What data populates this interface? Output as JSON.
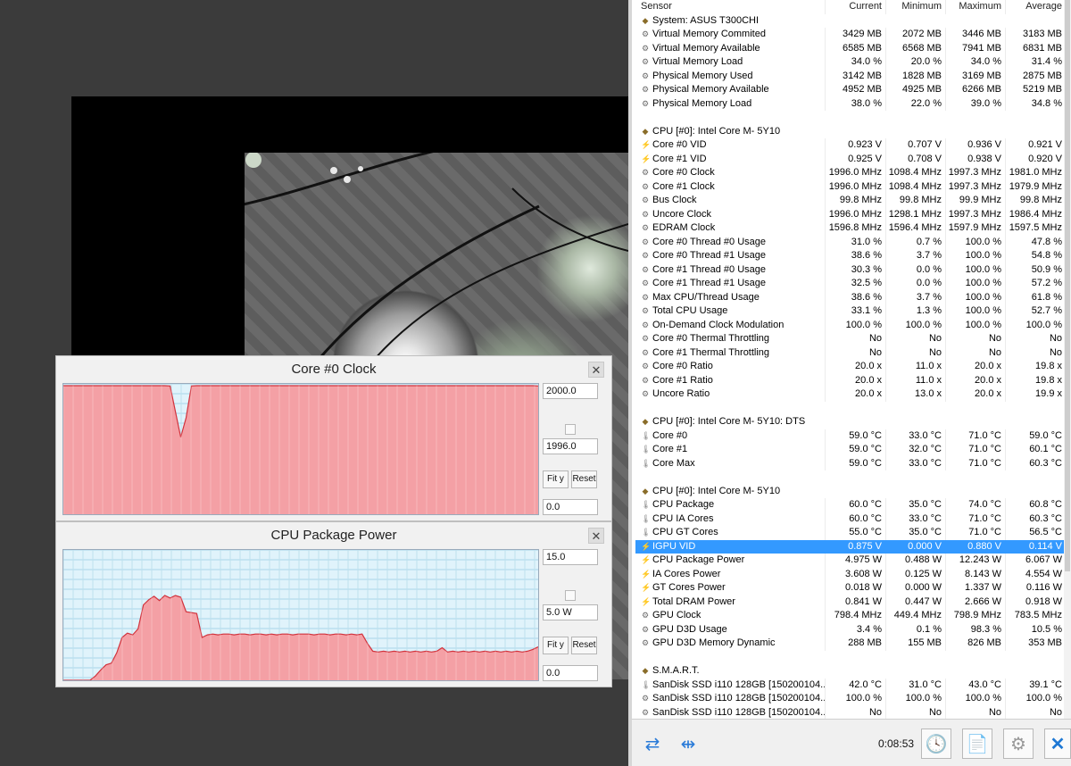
{
  "graph1": {
    "title": "Core #0 Clock",
    "max_field": "2000.0",
    "current_field": "1996.0",
    "min_field": "0.0",
    "fit_label": "Fit y",
    "reset_label": "Reset",
    "series": [
      2000,
      2000,
      2000,
      2000,
      2000,
      2000,
      2000,
      2000,
      2000,
      2000,
      2000,
      2000,
      2000,
      2000,
      2000,
      2000,
      2000,
      2000,
      2000,
      2000,
      1996,
      1600,
      1200,
      1500,
      1996,
      2000,
      2000,
      2000,
      2000,
      2000,
      2000,
      2000,
      2000,
      2000,
      2000,
      2000,
      2000,
      2000,
      2000,
      2000,
      2000,
      2000,
      2000,
      2000,
      2000,
      2000,
      2000,
      2000,
      2000,
      2000,
      2000,
      2000,
      2000,
      2000,
      2000,
      2000,
      2000,
      2000,
      2000,
      2000,
      2000,
      2000,
      2000,
      2000,
      2000,
      2000,
      2000,
      2000,
      2000,
      2000,
      2000,
      2000,
      2000,
      2000,
      2000,
      2000,
      2000,
      2000,
      2000,
      2000,
      2000,
      2000,
      2000,
      2000,
      2000,
      2000,
      2000,
      2000,
      2000,
      1996
    ],
    "ymax": 2000,
    "colors": {
      "fill": "#f4a0a5",
      "line": "#d2323c",
      "grid": "#a8d6e8",
      "bg": "#e0f3fb"
    }
  },
  "graph2": {
    "title": "CPU Package Power",
    "max_field": "15.0",
    "current_field": "5.0 W",
    "min_field": "0.0",
    "fit_label": "Fit y",
    "reset_label": "Reset",
    "series": [
      0,
      0,
      0,
      0,
      0,
      0,
      0.5,
      1.2,
      1.8,
      2.0,
      3.2,
      5.0,
      5.5,
      5.3,
      6.0,
      8.8,
      9.4,
      9.8,
      9.3,
      9.9,
      9.6,
      9.9,
      9.7,
      8.0,
      7.9,
      7.8,
      5.0,
      5.3,
      5.4,
      5.3,
      5.4,
      5.4,
      5.3,
      5.4,
      5.4,
      5.3,
      5.4,
      5.4,
      5.3,
      5.4,
      5.3,
      5.4,
      5.4,
      5.3,
      5.4,
      5.4,
      5.4,
      5.3,
      5.4,
      5.4,
      5.3,
      5.4,
      5.4,
      5.3,
      5.4,
      5.3,
      5.4,
      4.3,
      3.4,
      3.3,
      3.4,
      3.3,
      3.4,
      3.3,
      3.4,
      3.3,
      3.4,
      3.3,
      3.4,
      3.3,
      3.4,
      3.8,
      3.3,
      3.4,
      3.3,
      3.4,
      3.3,
      3.4,
      3.3,
      3.4,
      3.3,
      3.4,
      3.3,
      3.4,
      3.3,
      3.4,
      3.3,
      3.4,
      3.6,
      3.9
    ],
    "ymax": 15,
    "colors": {
      "fill": "#f4a0a5",
      "line": "#d2323c",
      "grid": "#a8d6e8",
      "bg": "#e0f3fb"
    }
  },
  "sensor_panel": {
    "columns": [
      "Sensor",
      "Current",
      "Minimum",
      "Maximum",
      "Average"
    ],
    "rows": [
      {
        "type": "group",
        "label": "System: ASUS T300CHI"
      },
      {
        "type": "item",
        "icon": "gear",
        "label": "Virtual Memory Commited",
        "cur": "3429 MB",
        "min": "2072 MB",
        "max": "3446 MB",
        "avg": "3183 MB"
      },
      {
        "type": "item",
        "icon": "gear",
        "label": "Virtual Memory Available",
        "cur": "6585 MB",
        "min": "6568 MB",
        "max": "7941 MB",
        "avg": "6831 MB"
      },
      {
        "type": "item",
        "icon": "gear",
        "label": "Virtual Memory Load",
        "cur": "34.0 %",
        "min": "20.0 %",
        "max": "34.0 %",
        "avg": "31.4 %"
      },
      {
        "type": "item",
        "icon": "gear",
        "label": "Physical Memory Used",
        "cur": "3142 MB",
        "min": "1828 MB",
        "max": "3169 MB",
        "avg": "2875 MB"
      },
      {
        "type": "item",
        "icon": "gear",
        "label": "Physical Memory Available",
        "cur": "4952 MB",
        "min": "4925 MB",
        "max": "6266 MB",
        "avg": "5219 MB"
      },
      {
        "type": "item",
        "icon": "gear",
        "label": "Physical Memory Load",
        "cur": "38.0 %",
        "min": "22.0 %",
        "max": "39.0 %",
        "avg": "34.8 %"
      },
      {
        "type": "blank"
      },
      {
        "type": "group",
        "label": "CPU [#0]: Intel Core M- 5Y10"
      },
      {
        "type": "item",
        "icon": "bolt",
        "label": "Core #0 VID",
        "cur": "0.923 V",
        "min": "0.707 V",
        "max": "0.936 V",
        "avg": "0.921 V"
      },
      {
        "type": "item",
        "icon": "bolt",
        "label": "Core #1 VID",
        "cur": "0.925 V",
        "min": "0.708 V",
        "max": "0.938 V",
        "avg": "0.920 V"
      },
      {
        "type": "item",
        "icon": "gear",
        "label": "Core #0 Clock",
        "cur": "1996.0 MHz",
        "min": "1098.4 MHz",
        "max": "1997.3 MHz",
        "avg": "1981.0 MHz"
      },
      {
        "type": "item",
        "icon": "gear",
        "label": "Core #1 Clock",
        "cur": "1996.0 MHz",
        "min": "1098.4 MHz",
        "max": "1997.3 MHz",
        "avg": "1979.9 MHz"
      },
      {
        "type": "item",
        "icon": "gear",
        "label": "Bus Clock",
        "cur": "99.8 MHz",
        "min": "99.8 MHz",
        "max": "99.9 MHz",
        "avg": "99.8 MHz"
      },
      {
        "type": "item",
        "icon": "gear",
        "label": "Uncore Clock",
        "cur": "1996.0 MHz",
        "min": "1298.1 MHz",
        "max": "1997.3 MHz",
        "avg": "1986.4 MHz"
      },
      {
        "type": "item",
        "icon": "gear",
        "label": "EDRAM Clock",
        "cur": "1596.8 MHz",
        "min": "1596.4 MHz",
        "max": "1597.9 MHz",
        "avg": "1597.5 MHz"
      },
      {
        "type": "item",
        "icon": "gear",
        "label": "Core #0 Thread #0 Usage",
        "cur": "31.0 %",
        "min": "0.7 %",
        "max": "100.0 %",
        "avg": "47.8 %"
      },
      {
        "type": "item",
        "icon": "gear",
        "label": "Core #0 Thread #1 Usage",
        "cur": "38.6 %",
        "min": "3.7 %",
        "max": "100.0 %",
        "avg": "54.8 %"
      },
      {
        "type": "item",
        "icon": "gear",
        "label": "Core #1 Thread #0 Usage",
        "cur": "30.3 %",
        "min": "0.0 %",
        "max": "100.0 %",
        "avg": "50.9 %"
      },
      {
        "type": "item",
        "icon": "gear",
        "label": "Core #1 Thread #1 Usage",
        "cur": "32.5 %",
        "min": "0.0 %",
        "max": "100.0 %",
        "avg": "57.2 %"
      },
      {
        "type": "item",
        "icon": "gear",
        "label": "Max CPU/Thread Usage",
        "cur": "38.6 %",
        "min": "3.7 %",
        "max": "100.0 %",
        "avg": "61.8 %"
      },
      {
        "type": "item",
        "icon": "gear",
        "label": "Total CPU Usage",
        "cur": "33.1 %",
        "min": "1.3 %",
        "max": "100.0 %",
        "avg": "52.7 %"
      },
      {
        "type": "item",
        "icon": "gear",
        "label": "On-Demand Clock Modulation",
        "cur": "100.0 %",
        "min": "100.0 %",
        "max": "100.0 %",
        "avg": "100.0 %"
      },
      {
        "type": "item",
        "icon": "gear",
        "label": "Core #0 Thermal Throttling",
        "cur": "No",
        "min": "No",
        "max": "No",
        "avg": "No"
      },
      {
        "type": "item",
        "icon": "gear",
        "label": "Core #1 Thermal Throttling",
        "cur": "No",
        "min": "No",
        "max": "No",
        "avg": "No"
      },
      {
        "type": "item",
        "icon": "gear",
        "label": "Core #0 Ratio",
        "cur": "20.0 x",
        "min": "11.0 x",
        "max": "20.0 x",
        "avg": "19.8 x"
      },
      {
        "type": "item",
        "icon": "gear",
        "label": "Core #1 Ratio",
        "cur": "20.0 x",
        "min": "11.0 x",
        "max": "20.0 x",
        "avg": "19.8 x"
      },
      {
        "type": "item",
        "icon": "gear",
        "label": "Uncore Ratio",
        "cur": "20.0 x",
        "min": "13.0 x",
        "max": "20.0 x",
        "avg": "19.9 x"
      },
      {
        "type": "blank"
      },
      {
        "type": "group",
        "label": "CPU [#0]: Intel Core M- 5Y10: DTS"
      },
      {
        "type": "item",
        "icon": "therm",
        "label": "Core #0",
        "cur": "59.0 °C",
        "min": "33.0 °C",
        "max": "71.0 °C",
        "avg": "59.0 °C"
      },
      {
        "type": "item",
        "icon": "therm",
        "label": "Core #1",
        "cur": "59.0 °C",
        "min": "32.0 °C",
        "max": "71.0 °C",
        "avg": "60.1 °C"
      },
      {
        "type": "item",
        "icon": "therm",
        "label": "Core Max",
        "cur": "59.0 °C",
        "min": "33.0 °C",
        "max": "71.0 °C",
        "avg": "60.3 °C"
      },
      {
        "type": "blank"
      },
      {
        "type": "group",
        "label": "CPU [#0]: Intel Core M- 5Y10"
      },
      {
        "type": "item",
        "icon": "therm",
        "label": "CPU Package",
        "cur": "60.0 °C",
        "min": "35.0 °C",
        "max": "74.0 °C",
        "avg": "60.8 °C"
      },
      {
        "type": "item",
        "icon": "therm",
        "label": "CPU IA Cores",
        "cur": "60.0 °C",
        "min": "33.0 °C",
        "max": "71.0 °C",
        "avg": "60.3 °C"
      },
      {
        "type": "item",
        "icon": "therm",
        "label": "CPU GT Cores",
        "cur": "55.0 °C",
        "min": "35.0 °C",
        "max": "71.0 °C",
        "avg": "56.5 °C"
      },
      {
        "type": "item",
        "icon": "bolt",
        "label": "IGPU VID",
        "cur": "0.875 V",
        "min": "0.000 V",
        "max": "0.880 V",
        "avg": "0.114 V",
        "selected": true
      },
      {
        "type": "item",
        "icon": "bolt",
        "label": "CPU Package Power",
        "cur": "4.975 W",
        "min": "0.488 W",
        "max": "12.243 W",
        "avg": "6.067 W"
      },
      {
        "type": "item",
        "icon": "bolt",
        "label": "IA Cores Power",
        "cur": "3.608 W",
        "min": "0.125 W",
        "max": "8.143 W",
        "avg": "4.554 W"
      },
      {
        "type": "item",
        "icon": "bolt",
        "label": "GT Cores Power",
        "cur": "0.018 W",
        "min": "0.000 W",
        "max": "1.337 W",
        "avg": "0.116 W"
      },
      {
        "type": "item",
        "icon": "bolt",
        "label": "Total DRAM Power",
        "cur": "0.841 W",
        "min": "0.447 W",
        "max": "2.666 W",
        "avg": "0.918 W"
      },
      {
        "type": "item",
        "icon": "gear",
        "label": "GPU Clock",
        "cur": "798.4 MHz",
        "min": "449.4 MHz",
        "max": "798.9 MHz",
        "avg": "783.5 MHz"
      },
      {
        "type": "item",
        "icon": "gear",
        "label": "GPU D3D Usage",
        "cur": "3.4 %",
        "min": "0.1 %",
        "max": "98.3 %",
        "avg": "10.5 %"
      },
      {
        "type": "item",
        "icon": "gear",
        "label": "GPU D3D Memory Dynamic",
        "cur": "288 MB",
        "min": "155 MB",
        "max": "826 MB",
        "avg": "353 MB"
      },
      {
        "type": "blank"
      },
      {
        "type": "group",
        "label": "S.M.A.R.T."
      },
      {
        "type": "item",
        "icon": "therm",
        "label": "SanDisk SSD i110 128GB [150200104...",
        "cur": "42.0 °C",
        "min": "31.0 °C",
        "max": "43.0 °C",
        "avg": "39.1 °C"
      },
      {
        "type": "item",
        "icon": "gear",
        "label": "SanDisk SSD i110 128GB [150200104...",
        "cur": "100.0 %",
        "min": "100.0 %",
        "max": "100.0 %",
        "avg": "100.0 %"
      },
      {
        "type": "item",
        "icon": "gear",
        "label": "SanDisk SSD i110 128GB [150200104...",
        "cur": "No",
        "min": "No",
        "max": "No",
        "avg": "No"
      }
    ]
  },
  "footer": {
    "timer": "0:08:53"
  },
  "icons": {
    "gear": "⚙",
    "bolt": "⚡",
    "therm": "🌡",
    "group": "◆"
  },
  "colors": {
    "selection": "#3399ff",
    "graph_fill": "#f4a0a5",
    "graph_line": "#d2323c"
  }
}
